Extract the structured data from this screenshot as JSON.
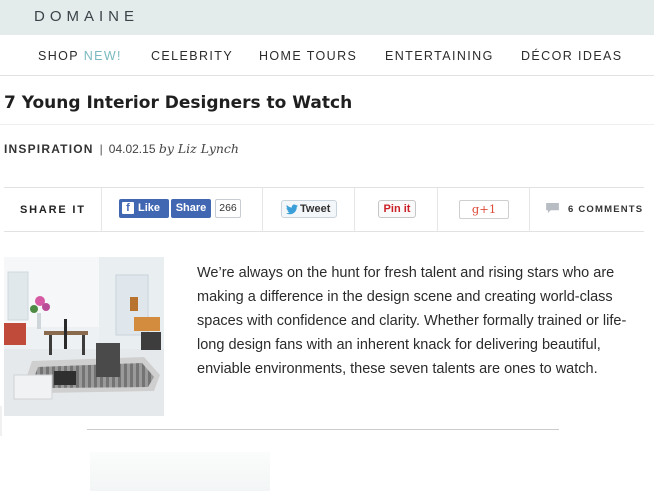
{
  "site": {
    "logo": "DOMAINE"
  },
  "nav": {
    "items": [
      {
        "label": "SHOP",
        "badge": "NEW!"
      },
      {
        "label": "CELEBRITY"
      },
      {
        "label": "HOME TOURS"
      },
      {
        "label": "ENTERTAINING"
      },
      {
        "label": "DÉCOR IDEAS"
      }
    ]
  },
  "article": {
    "title": "7 Young Interior Designers to Watch",
    "category": "INSPIRATION",
    "separator": "|",
    "date": "04.02.15",
    "byline": "by Liz Lynch",
    "body": "We’re always on the hunt for fresh talent and rising stars who are making a difference in the design scene and creating world-class spaces with confidence and clarity. Whether formally trained or life-long design fans with an inherent knack for delivering beautiful, enviable environments, these seven talents are ones to watch."
  },
  "share": {
    "label": "SHARE IT",
    "facebook_like": "Like",
    "facebook_share": "Share",
    "facebook_count": "266",
    "tweet": "Tweet",
    "pinterest": "Pin it",
    "gplus": "g+1",
    "comments": "6 COMMENTS"
  },
  "colors": {
    "topbar": "#e4eceb",
    "accent_new": "#7ab9bf",
    "facebook": "#4267b2",
    "pinterest": "#cb2027",
    "gplus": "#dd4b39"
  }
}
